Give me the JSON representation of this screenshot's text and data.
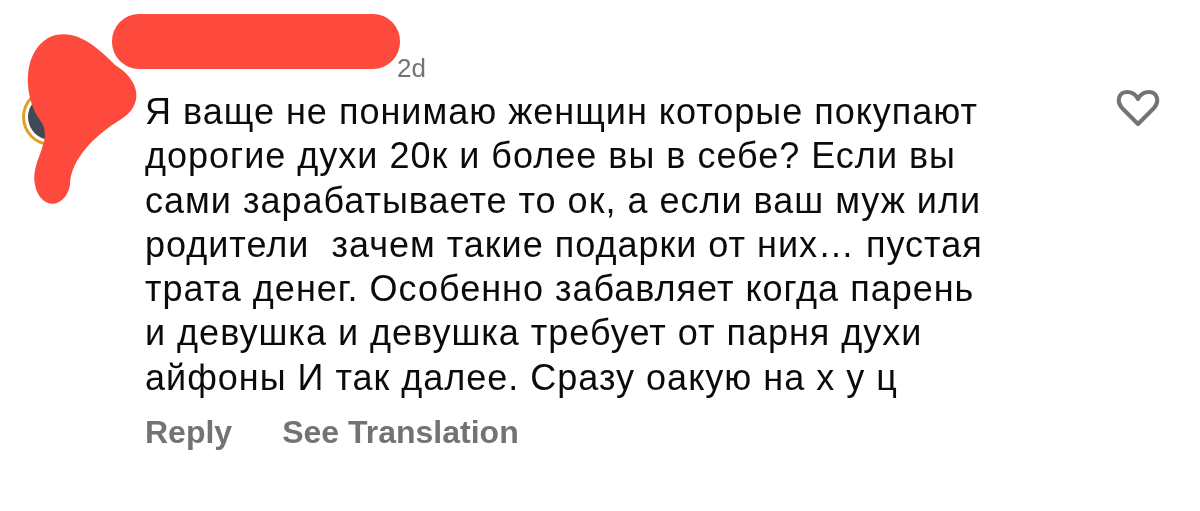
{
  "comment": {
    "time": "2d",
    "text": "Я ваще не понимаю женщин которые покупают\nдорогие духи 20к и более вы в себе? Если вы\nсами зарабатываете то ок, а если ваш муж или\nродители  зачем такие подарки от них… пустая\nтрата денег. Особенно забавляет когда парень\nи девушка и девушка требует от парня духи\nайфоны И так далее. Сразу оакую на х у ц",
    "liked": false,
    "actions": [
      "Reply",
      "See Translation"
    ]
  }
}
